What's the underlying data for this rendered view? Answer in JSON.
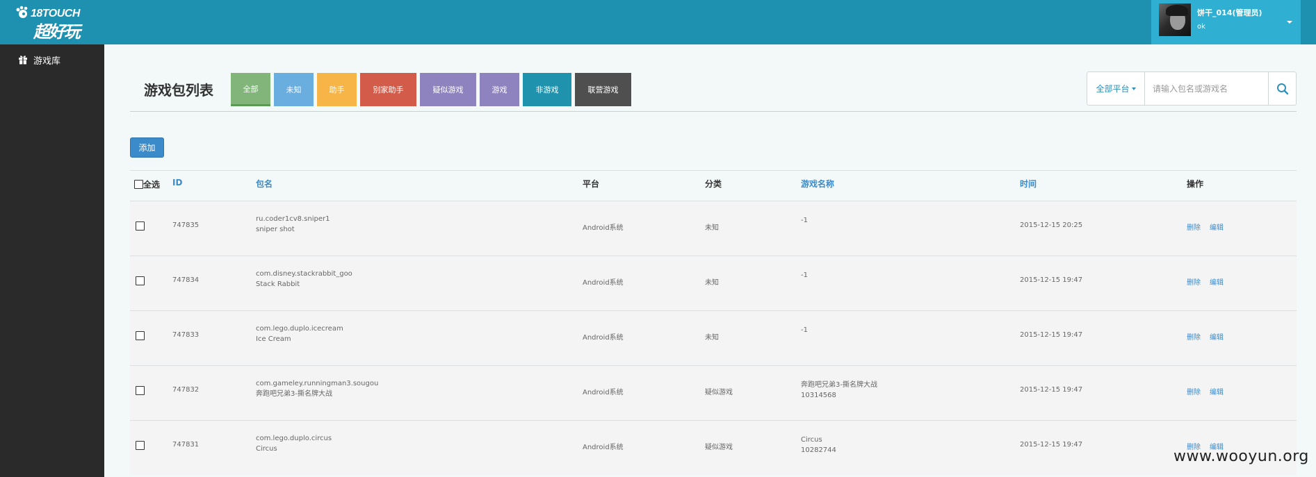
{
  "header": {
    "logo_top": "18TOUCH",
    "logo_bottom": "超好玩",
    "user": {
      "name": "饼干_014(管理员)",
      "status": "ok"
    }
  },
  "sidebar": {
    "items": [
      {
        "label": "游戏库",
        "icon": "gift-icon"
      }
    ]
  },
  "page": {
    "title": "游戏包列表",
    "filters": [
      {
        "label": "全部",
        "color": "#82b57a"
      },
      {
        "label": "未知",
        "color": "#6aaee0"
      },
      {
        "label": "助手",
        "color": "#f7b547"
      },
      {
        "label": "别家助手",
        "color": "#d35b4a"
      },
      {
        "label": "疑似游戏",
        "color": "#8e82bf"
      },
      {
        "label": "游戏",
        "color": "#8e82bf"
      },
      {
        "label": "非游戏",
        "color": "#1f92ad"
      },
      {
        "label": "联营游戏",
        "color": "#4f4f4f"
      }
    ],
    "search": {
      "platform": "全部平台",
      "placeholder": "请输入包名或游戏名"
    },
    "add_label": "添加"
  },
  "table": {
    "columns": {
      "select_all": "全选",
      "id": "ID",
      "package": "包名",
      "platform": "平台",
      "category": "分类",
      "game_name": "游戏名称",
      "time": "时间",
      "actions": "操作"
    },
    "delete_label": "删除",
    "edit_label": "编辑",
    "rows": [
      {
        "id": "747835",
        "package": "ru.coder1cv8.sniper1",
        "package_title": "sniper shot",
        "platform": "Android系统",
        "category": "未知",
        "game_name": "",
        "game_sub": "-1",
        "time": "2015-12-15 20:25"
      },
      {
        "id": "747834",
        "package": "com.disney.stackrabbit_goo",
        "package_title": "Stack Rabbit",
        "platform": "Android系统",
        "category": "未知",
        "game_name": "",
        "game_sub": "-1",
        "time": "2015-12-15 19:47"
      },
      {
        "id": "747833",
        "package": "com.lego.duplo.icecream",
        "package_title": "Ice Cream",
        "platform": "Android系统",
        "category": "未知",
        "game_name": "",
        "game_sub": "-1",
        "time": "2015-12-15 19:47"
      },
      {
        "id": "747832",
        "package": "com.gameley.runningman3.sougou",
        "package_title": "奔跑吧兄弟3-撕名牌大战",
        "platform": "Android系统",
        "category": "疑似游戏",
        "game_name": "奔跑吧兄弟3-撕名牌大战",
        "game_sub": "10314568",
        "time": "2015-12-15 19:47"
      },
      {
        "id": "747831",
        "package": "com.lego.duplo.circus",
        "package_title": "Circus",
        "platform": "Android系统",
        "category": "疑似游戏",
        "game_name": "Circus",
        "game_sub": "10282744",
        "time": "2015-12-15 19:47"
      }
    ]
  },
  "watermark": "www.wooyun.org"
}
